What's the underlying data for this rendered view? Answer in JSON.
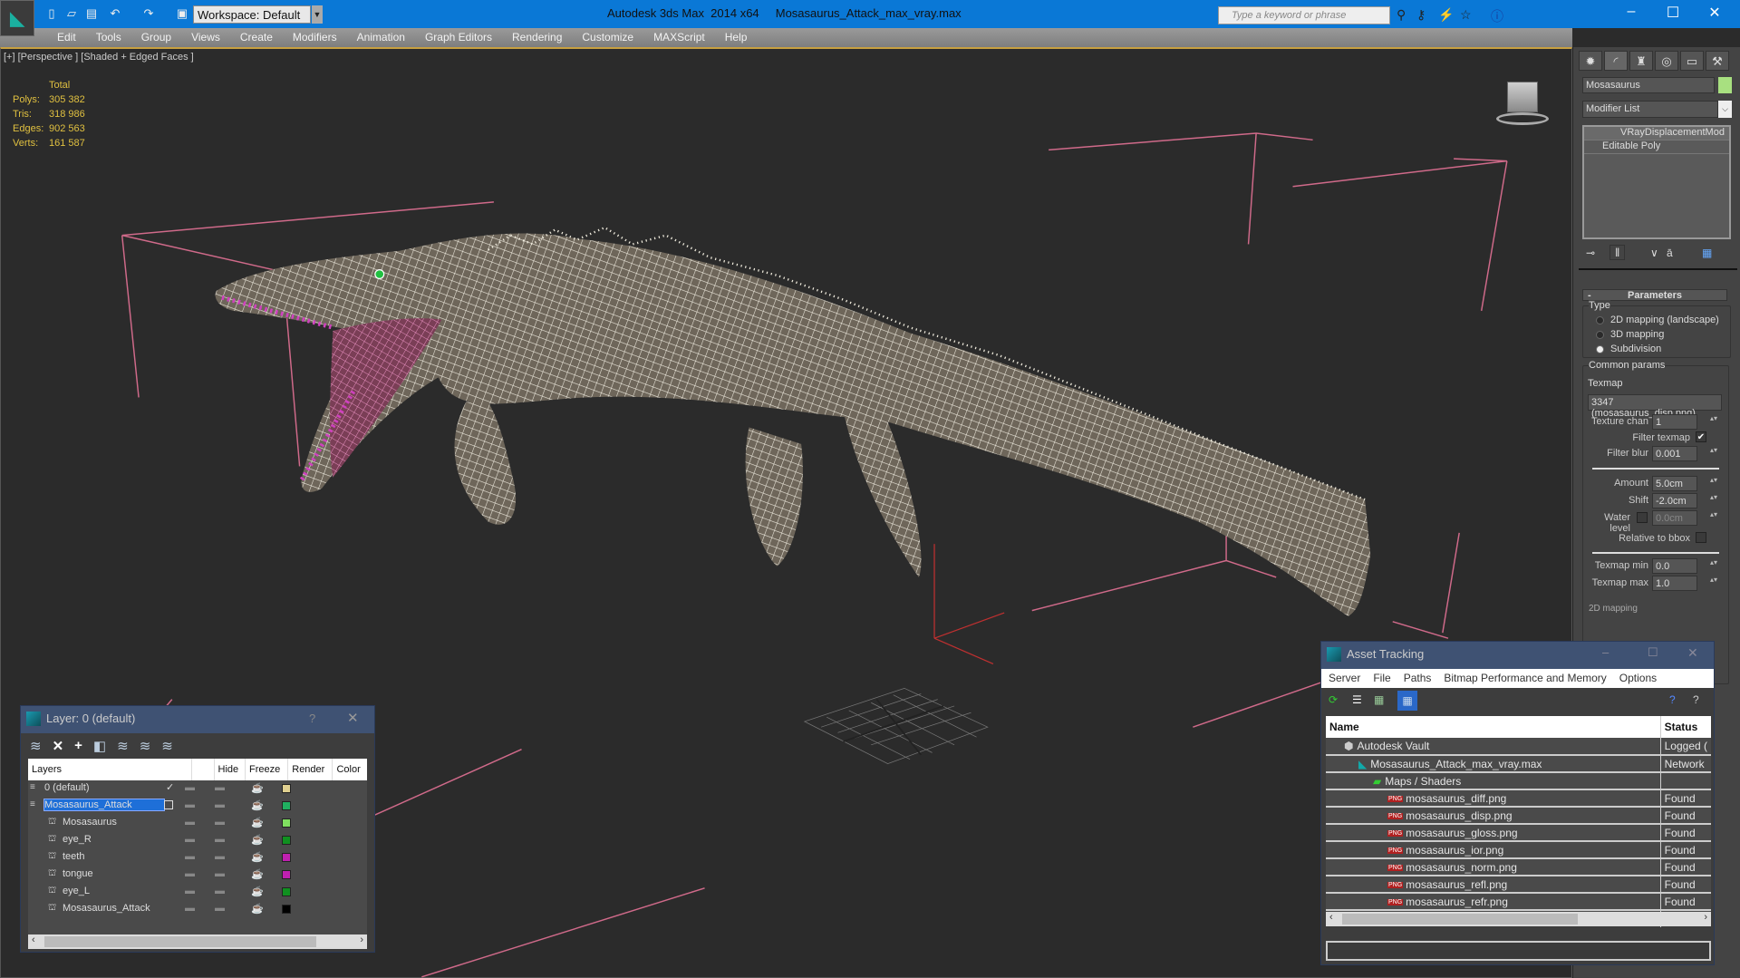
{
  "titlebar": {
    "workspace": "Workspace: Default",
    "app_name": "Autodesk 3ds Max  2014 x64",
    "file_name": "Mosasaurus_Attack_max_vray.max",
    "search_placeholder": "Type a keyword or phrase"
  },
  "menu": [
    "Edit",
    "Tools",
    "Group",
    "Views",
    "Create",
    "Modifiers",
    "Animation",
    "Graph Editors",
    "Rendering",
    "Customize",
    "MAXScript",
    "Help"
  ],
  "viewport": {
    "label": "[+] [Perspective ] [Shaded + Edged Faces ]",
    "stats_header": "Total",
    "stats": [
      {
        "label": "Polys:",
        "value": "305 382"
      },
      {
        "label": "Tris:",
        "value": "318 986"
      },
      {
        "label": "Edges:",
        "value": "902 563"
      },
      {
        "label": "Verts:",
        "value": "161 587"
      }
    ]
  },
  "command_panel": {
    "object_name": "Mosasaurus",
    "object_color": "#a8e080",
    "modifier_list": "Modifier List",
    "stack": [
      "VRayDisplacementMod",
      "Editable Poly"
    ],
    "rollout_title": "Parameters",
    "type_label": "Type",
    "type_options": [
      "2D mapping (landscape)",
      "3D mapping",
      "Subdivision"
    ],
    "type_selected": 2,
    "common_label": "Common params",
    "texmap_label": "Texmap",
    "texmap_value": "3347 (mosasaurus_disp.png)",
    "texture_chan_label": "Texture chan",
    "texture_chan": "1",
    "filter_texmap_label": "Filter texmap",
    "filter_texmap": true,
    "filter_blur_label": "Filter blur",
    "filter_blur": "0.001",
    "amount_label": "Amount",
    "amount": "5.0cm",
    "shift_label": "Shift",
    "shift": "-2.0cm",
    "water_level_label": "Water level",
    "water_level": "0.0cm",
    "relative_bbox_label": "Relative to bbox",
    "texmap_min_label": "Texmap min",
    "texmap_min": "0.0",
    "texmap_max_label": "Texmap max",
    "texmap_max": "1.0",
    "next_rollout": "2D mapping"
  },
  "layer_dialog": {
    "title": "Layer: 0 (default)",
    "help": "?",
    "columns": [
      "Layers",
      "",
      "Hide",
      "Freeze",
      "Render",
      "Color"
    ],
    "rows": [
      {
        "name": "0 (default)",
        "color": "#e0d090",
        "active": true
      },
      {
        "name": "Mosasaurus_Attack",
        "color": "#20b060",
        "selected": true
      },
      {
        "name": "Mosasaurus",
        "color": "#80e060"
      },
      {
        "name": "eye_R",
        "color": "#109020"
      },
      {
        "name": "teeth",
        "color": "#c020b0"
      },
      {
        "name": "tongue",
        "color": "#c020b0"
      },
      {
        "name": "eye_L",
        "color": "#109020"
      },
      {
        "name": "Mosasaurus_Attack",
        "color": "#000000"
      }
    ]
  },
  "asset_tracking": {
    "title": "Asset Tracking",
    "menu": [
      "Server",
      "File",
      "Paths",
      "Bitmap Performance and Memory",
      "Options"
    ],
    "columns": [
      "Name",
      "Status"
    ],
    "rows": [
      {
        "name": "Autodesk Vault",
        "status": "Logged (",
        "level": 0,
        "icon": "vault"
      },
      {
        "name": "Mosasaurus_Attack_max_vray.max",
        "status": "Network",
        "level": 1,
        "icon": "max"
      },
      {
        "name": "Maps / Shaders",
        "status": "",
        "level": 2,
        "icon": "maps"
      },
      {
        "name": "mosasaurus_diff.png",
        "status": "Found",
        "level": 3,
        "icon": "png"
      },
      {
        "name": "mosasaurus_disp.png",
        "status": "Found",
        "level": 3,
        "icon": "png"
      },
      {
        "name": "mosasaurus_gloss.png",
        "status": "Found",
        "level": 3,
        "icon": "png"
      },
      {
        "name": "mosasaurus_ior.png",
        "status": "Found",
        "level": 3,
        "icon": "png"
      },
      {
        "name": "mosasaurus_norm.png",
        "status": "Found",
        "level": 3,
        "icon": "png"
      },
      {
        "name": "mosasaurus_refl.png",
        "status": "Found",
        "level": 3,
        "icon": "png"
      },
      {
        "name": "mosasaurus_refr.png",
        "status": "Found",
        "level": 3,
        "icon": "png"
      }
    ]
  }
}
